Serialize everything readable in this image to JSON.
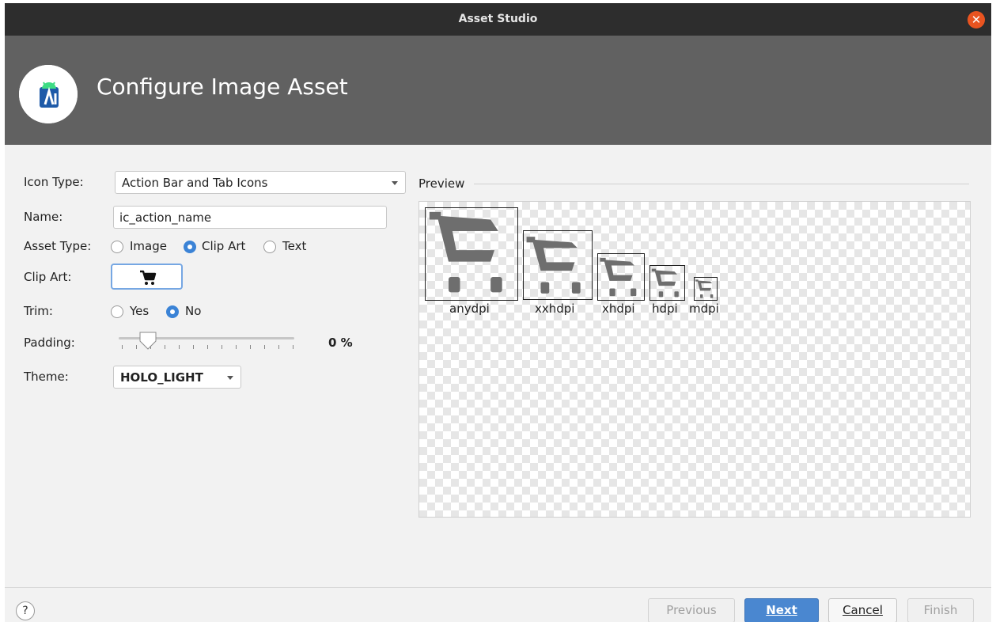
{
  "window": {
    "title": "Asset Studio",
    "close_icon": "close-icon"
  },
  "header": {
    "title": "Configure Image Asset",
    "logo_icon": "android-studio-logo-icon"
  },
  "form": {
    "icon_type_label": "Icon Type:",
    "icon_type_value": "Action Bar and Tab Icons",
    "name_label": "Name:",
    "name_value": "ic_action_name",
    "asset_type_label": "Asset Type:",
    "asset_type_options": [
      "Image",
      "Clip Art",
      "Text"
    ],
    "asset_type_selected": "Clip Art",
    "clip_art_label": "Clip Art:",
    "clip_art_icon": "shopping-cart-icon",
    "trim_label": "Trim:",
    "trim_options": [
      "Yes",
      "No"
    ],
    "trim_selected": "No",
    "padding_label": "Padding:",
    "padding_value": "0 %",
    "padding_fraction": 0.0,
    "theme_label": "Theme:",
    "theme_value": "HOLO_LIGHT"
  },
  "preview": {
    "title": "Preview",
    "densities": [
      "anydpi",
      "xxhdpi",
      "xhdpi",
      "hdpi",
      "mdpi"
    ]
  },
  "footer": {
    "help_label": "?",
    "previous_label": "Previous",
    "next_label": "Next",
    "cancel_label": "Cancel",
    "finish_label": "Finish"
  },
  "colors": {
    "accent": "#3b83d6",
    "primary_button": "#4a87d0",
    "header_bg": "#616161",
    "titlebar_bg": "#2d2d2d",
    "close": "#e95420"
  }
}
